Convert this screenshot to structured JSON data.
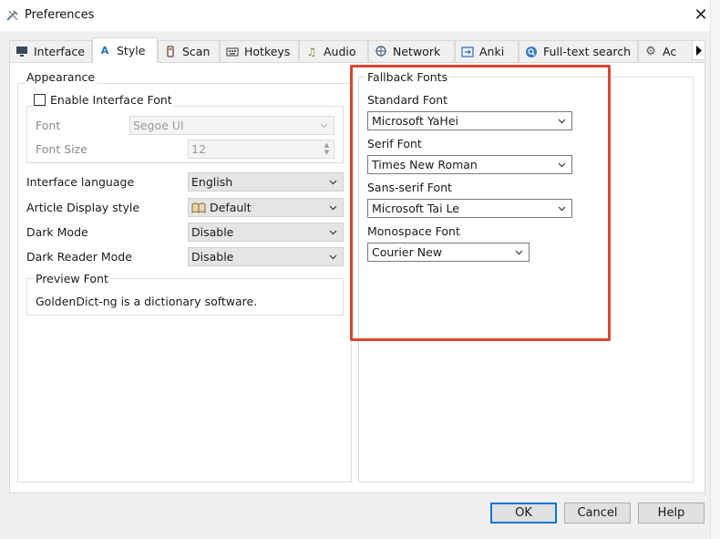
{
  "window": {
    "title": "Preferences",
    "close_glyph": "✕"
  },
  "tabs": [
    {
      "label": "Interface",
      "icon": "monitor-icon"
    },
    {
      "label": "Style",
      "icon": "style-icon"
    },
    {
      "label": "Scan",
      "icon": "scan-icon"
    },
    {
      "label": "Hotkeys",
      "icon": "keyboard-icon"
    },
    {
      "label": "Audio",
      "icon": "music-note-icon"
    },
    {
      "label": "Network",
      "icon": "network-icon"
    },
    {
      "label": "Anki",
      "icon": "anki-icon"
    },
    {
      "label": "Full-text search",
      "icon": "search-icon"
    },
    {
      "label": "Ac",
      "icon": "gear-icon"
    }
  ],
  "active_tab": "Style",
  "appearance": {
    "title": "Appearance",
    "enable_interface_font": {
      "label": "Enable Interface Font",
      "checked": false
    },
    "font": {
      "label": "Font",
      "value": "Segoe UI"
    },
    "font_size": {
      "label": "Font Size",
      "value": "12"
    },
    "interface_language": {
      "label": "Interface language",
      "value": "English"
    },
    "article_display_style": {
      "label": "Article Display style",
      "value": "Default"
    },
    "dark_mode": {
      "label": "Dark Mode",
      "value": "Disable"
    },
    "dark_reader_mode": {
      "label": "Dark Reader Mode",
      "value": "Disable"
    },
    "preview_font": {
      "title": "Preview Font",
      "text": "GoldenDict-ng is a dictionary software."
    }
  },
  "fallback_fonts": {
    "title": "Fallback Fonts",
    "standard": {
      "label": "Standard Font",
      "value": "Microsoft YaHei"
    },
    "serif": {
      "label": "Serif Font",
      "value": "Times New Roman"
    },
    "sans_serif": {
      "label": "Sans-serif Font",
      "value": "Microsoft Tai Le"
    },
    "monospace": {
      "label": "Monospace Font",
      "value": "Courier New"
    }
  },
  "buttons": {
    "ok": "OK",
    "cancel": "Cancel",
    "help": "Help"
  },
  "colors": {
    "highlight": "#d9472f",
    "accent": "#0078d7"
  }
}
